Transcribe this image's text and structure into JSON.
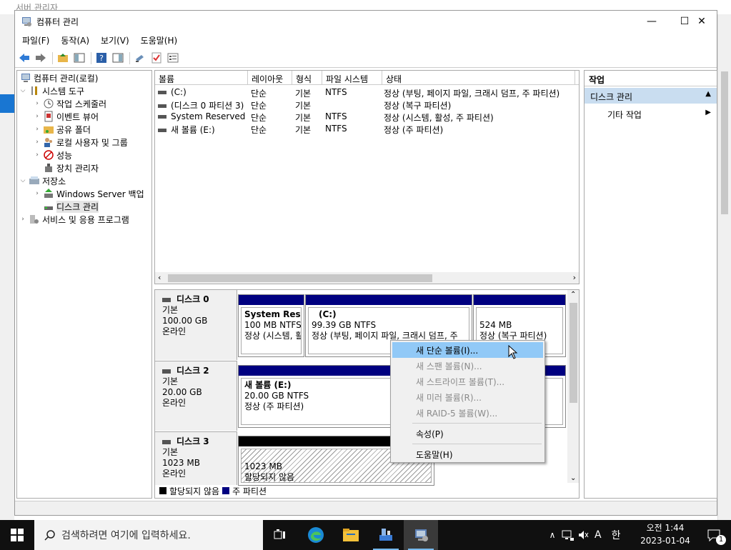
{
  "background": {
    "window_title": "서버 관리자"
  },
  "window": {
    "title": "컴퓨터 관리",
    "minimize": "—",
    "maximize": "☐",
    "close": "✕"
  },
  "menu": [
    "파일(F)",
    "동작(A)",
    "보기(V)",
    "도움말(H)"
  ],
  "tree": {
    "root": "컴퓨터 관리(로컬)",
    "system_tools": "시스템 도구",
    "task_scheduler": "작업 스케줄러",
    "event_viewer": "이벤트 뷰어",
    "shared_folders": "공유 폴더",
    "local_users": "로컬 사용자 및 그룹",
    "performance": "성능",
    "device_manager": "장치 관리자",
    "storage": "저장소",
    "backup": "Windows Server 백업",
    "disk_mgmt": "디스크 관리",
    "services": "서비스 및 응용 프로그램"
  },
  "volumes": {
    "headers": [
      "볼륨",
      "레이아웃",
      "형식",
      "파일 시스템",
      "상태"
    ],
    "rows": [
      [
        "(C:)",
        "단순",
        "기본",
        "NTFS",
        "정상 (부팅, 페이지 파일, 크래시 덤프, 주 파티션)"
      ],
      [
        "(디스크 0 파티션 3)",
        "단순",
        "기본",
        "",
        "정상 (복구 파티션)"
      ],
      [
        "System Reserved",
        "단순",
        "기본",
        "NTFS",
        "정상 (시스템, 활성, 주 파티션)"
      ],
      [
        "새 볼륨 (E:)",
        "단순",
        "기본",
        "NTFS",
        "정상 (주 파티션)"
      ]
    ]
  },
  "disks": [
    {
      "name": "디스크 0",
      "type": "기본",
      "size": "100.00 GB",
      "status": "온라인",
      "parts": [
        {
          "title": "System Reser",
          "size": "100 MB NTFS",
          "status": "정상 (시스템, 활"
        },
        {
          "title": "(C:)",
          "size": "99.39 GB NTFS",
          "status": "정상 (부팅, 페이지 파일, 크래시 덤프, 주"
        },
        {
          "title": "",
          "size": "524 MB",
          "status": "정상 (복구 파티션)"
        }
      ]
    },
    {
      "name": "디스크 2",
      "type": "기본",
      "size": "20.00 GB",
      "status": "온라인",
      "parts": [
        {
          "title": "새 볼륨  (E:)",
          "size": "20.00 GB NTFS",
          "status": "정상 (주 파티션)"
        }
      ]
    },
    {
      "name": "디스크 3",
      "type": "기본",
      "size": "1023 MB",
      "status": "온라인",
      "parts": [
        {
          "title": "",
          "size": "1023 MB",
          "status": "할당되지 않음"
        }
      ]
    }
  ],
  "legend": {
    "unallocated": "할당되지 않음",
    "primary": "주 파티션"
  },
  "actions": {
    "header": "작업",
    "section": "디스크 관리",
    "more": "기타 작업"
  },
  "context_menu": {
    "new_simple": "새 단순 볼륨(I)...",
    "new_spanned": "새 스팬 볼륨(N)...",
    "new_striped": "새 스트라이프 볼륨(T)...",
    "new_mirrored": "새 미러 볼륨(R)...",
    "new_raid5": "새 RAID-5 볼륨(W)...",
    "properties": "속성(P)",
    "help": "도움말(H)"
  },
  "taskbar": {
    "search_placeholder": "검색하려면 여기에 입력하세요.",
    "ime_a": "A",
    "ime_han": "한",
    "time": "오전 1:44",
    "date": "2023-01-04",
    "notif_count": "1"
  }
}
